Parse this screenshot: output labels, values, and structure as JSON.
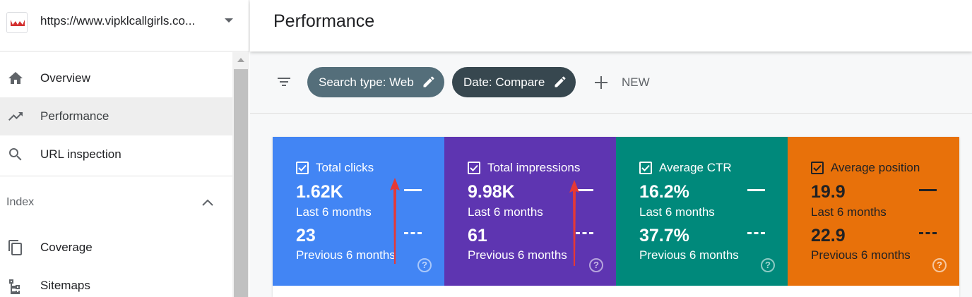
{
  "property": {
    "url": "https://www.vipklcallgirls.co...",
    "favicon_icon": "site-favicon"
  },
  "sidebar": {
    "items": [
      {
        "label": "Overview",
        "icon": "home-icon"
      },
      {
        "label": "Performance",
        "icon": "trending-up-icon"
      },
      {
        "label": "URL inspection",
        "icon": "search-icon"
      }
    ],
    "section_label": "Index",
    "section_items": [
      {
        "label": "Coverage",
        "icon": "copy-icon"
      },
      {
        "label": "Sitemaps",
        "icon": "sitemap-icon"
      }
    ]
  },
  "header": {
    "title": "Performance"
  },
  "filters": {
    "search_type_chip": "Search type: Web",
    "date_chip": "Date: Compare",
    "new_label": "NEW"
  },
  "metrics": [
    {
      "title": "Total clicks",
      "current_value": "1.62K",
      "current_period": "Last 6 months",
      "previous_value": "23",
      "previous_period": "Previous 6 months",
      "color": "#4285f4"
    },
    {
      "title": "Total impressions",
      "current_value": "9.98K",
      "current_period": "Last 6 months",
      "previous_value": "61",
      "previous_period": "Previous 6 months",
      "color": "#5e35b1"
    },
    {
      "title": "Average CTR",
      "current_value": "16.2%",
      "current_period": "Last 6 months",
      "previous_value": "37.7%",
      "previous_period": "Previous 6 months",
      "color": "#00897b"
    },
    {
      "title": "Average position",
      "current_value": "19.9",
      "current_period": "Last 6 months",
      "previous_value": "22.9",
      "previous_period": "Previous 6 months",
      "color": "#e8710a"
    }
  ],
  "colors": {
    "annotation_arrow": "#e53935",
    "chip_search": "#546e7a",
    "chip_date": "#37474f"
  }
}
